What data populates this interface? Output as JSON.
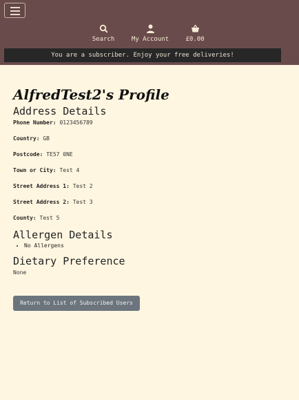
{
  "nav": {
    "search_label": "Search",
    "account_label": "My Account",
    "basket_total": "£0.00"
  },
  "banner_text": "You are a subscriber. Enjoy your free deliveries!",
  "profile": {
    "title": "AlfredTest2's Profile",
    "address_heading": "Address Details",
    "fields": [
      {
        "label": "Phone Number:",
        "value": "0123456789"
      },
      {
        "label": "Country:",
        "value": "GB"
      },
      {
        "label": "Postcode:",
        "value": "TE57 0NE"
      },
      {
        "label": "Town or City:",
        "value": "Test 4"
      },
      {
        "label": "Street Address 1:",
        "value": "Test 2"
      },
      {
        "label": "Street Address 2:",
        "value": "Test 3"
      },
      {
        "label": "County:",
        "value": "Test 5"
      }
    ],
    "allergen_heading": "Allergen Details",
    "allergens": [
      "No Allergens"
    ],
    "dietary_heading": "Dietary Preference",
    "dietary_value": "None"
  },
  "return_button_label": "Return to List of Subscribed Users"
}
